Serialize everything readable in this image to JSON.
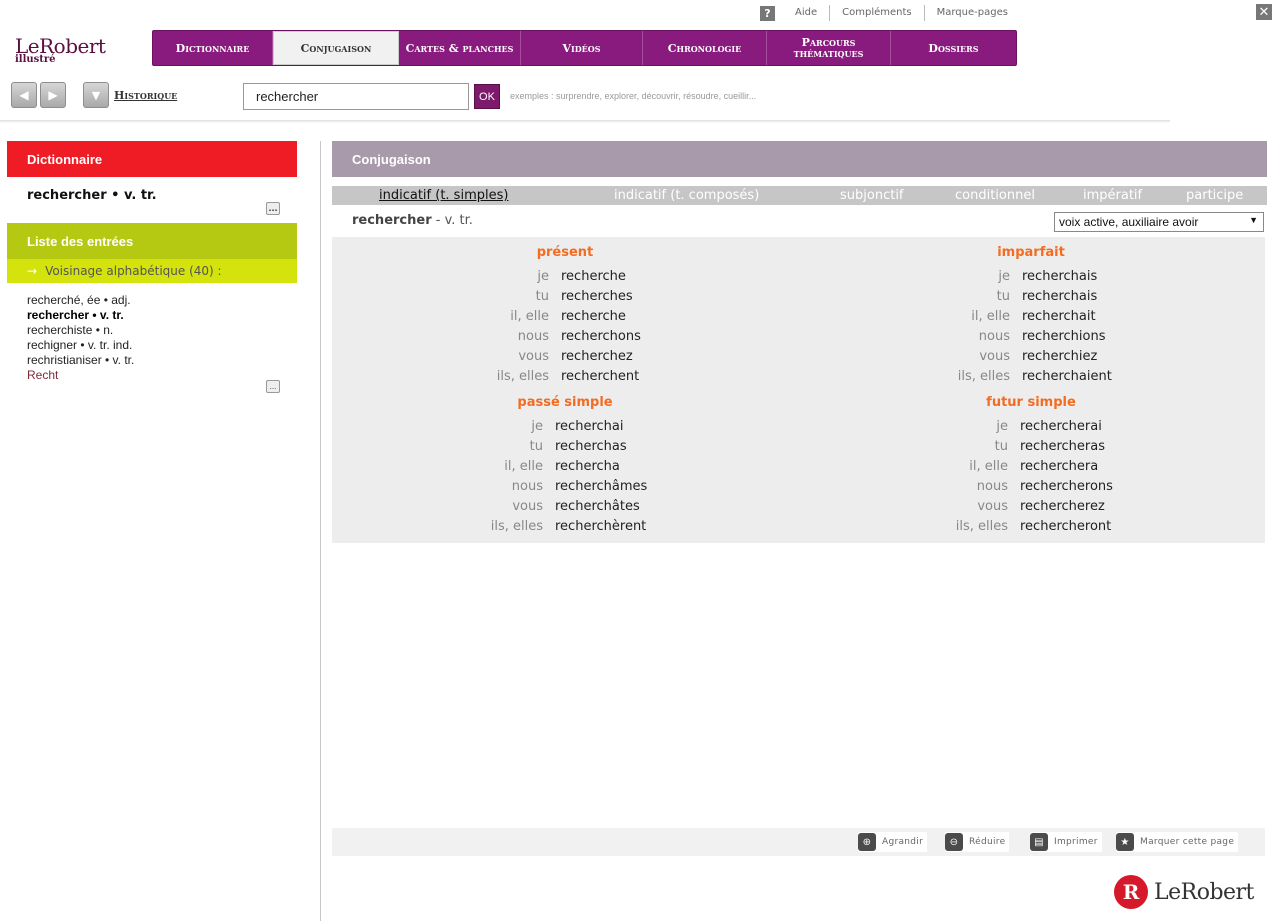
{
  "topbar": {
    "help_icon": "?",
    "links": [
      "Aide",
      "Compléments",
      "Marque-pages"
    ],
    "close_icon": "✕"
  },
  "logo": {
    "main": "LeRobert",
    "sub": "illustré"
  },
  "nav": {
    "tabs": [
      {
        "label": "Dictionnaire"
      },
      {
        "label": "Conjugaison",
        "active": true
      },
      {
        "label": "Cartes & planches"
      },
      {
        "label": "Vidéos"
      },
      {
        "label": "Chronologie"
      },
      {
        "label_line1": "Parcours",
        "label_line2": "thématiques"
      },
      {
        "label": "Dossiers"
      }
    ]
  },
  "toolbar": {
    "back_icon": "◀",
    "forward_icon": "▶",
    "history_dropdown_icon": "▼",
    "history_label": "Historique",
    "search_value": "rechercher",
    "ok_label": "OK",
    "examples": "exemples : surprendre, explorer, découvrir, résoudre, cueillir..."
  },
  "left": {
    "dict_title": "Dictionnaire",
    "dict_entry": "rechercher • v. tr.",
    "more_label": "...",
    "list_title": "Liste des entrées",
    "voisinage_arrow": "→",
    "voisinage": "Voisinage alphabétique (40) :",
    "entries": [
      {
        "text": "recherché, ée • adj."
      },
      {
        "text": "rechercher • v. tr.",
        "current": true
      },
      {
        "text": "recherchiste • n."
      },
      {
        "text": "rechigner • v. tr. ind."
      },
      {
        "text": "rechristianiser • v. tr."
      },
      {
        "text": "Recht",
        "link": true
      }
    ]
  },
  "conj": {
    "title": "Conjugaison",
    "modes": [
      {
        "label": "indicatif (t. simples)",
        "active": true
      },
      {
        "label": "indicatif (t. composés)"
      },
      {
        "label": "subjonctif"
      },
      {
        "label": "conditionnel"
      },
      {
        "label": "impératif"
      },
      {
        "label": "participe"
      }
    ],
    "verb": "rechercher",
    "verb_type": " - v. tr.",
    "voice": "voix active, auxiliaire avoir",
    "voice_caret": "▼",
    "tenses": [
      {
        "name": "présent",
        "rows": [
          [
            "je",
            "recherche"
          ],
          [
            "tu",
            "recherches"
          ],
          [
            "il, elle",
            "recherche"
          ],
          [
            "nous",
            "recherchons"
          ],
          [
            "vous",
            "recherchez"
          ],
          [
            "ils, elles",
            "recherchent"
          ]
        ]
      },
      {
        "name": "imparfait",
        "rows": [
          [
            "je",
            "recherchais"
          ],
          [
            "tu",
            "recherchais"
          ],
          [
            "il, elle",
            "recherchait"
          ],
          [
            "nous",
            "recherchions"
          ],
          [
            "vous",
            "recherchiez"
          ],
          [
            "ils, elles",
            "recherchaient"
          ]
        ]
      },
      {
        "name": "passé simple",
        "rows": [
          [
            "je",
            "recherchai"
          ],
          [
            "tu",
            "recherchas"
          ],
          [
            "il, elle",
            "rechercha"
          ],
          [
            "nous",
            "recherchâmes"
          ],
          [
            "vous",
            "recherchâtes"
          ],
          [
            "ils, elles",
            "recherchèrent"
          ]
        ]
      },
      {
        "name": "futur simple",
        "rows": [
          [
            "je",
            "rechercherai"
          ],
          [
            "tu",
            "rechercheras"
          ],
          [
            "il, elle",
            "recherchera"
          ],
          [
            "nous",
            "rechercherons"
          ],
          [
            "vous",
            "rechercherez"
          ],
          [
            "ils, elles",
            "rechercheront"
          ]
        ]
      }
    ]
  },
  "bottom": {
    "tools": [
      {
        "label": "Agrandir",
        "icon": "zoom-in-icon"
      },
      {
        "label": "Réduire",
        "icon": "zoom-out-icon"
      },
      {
        "label": "Imprimer",
        "icon": "print-icon"
      },
      {
        "label": "Marquer cette page",
        "icon": "bookmark-icon"
      }
    ]
  },
  "footer": {
    "logo_letter": "R",
    "logo_word": "LeRobert"
  },
  "colors": {
    "nav_bg": "#8a1b7e",
    "dict_header": "#ef1c25",
    "list_header": "#b5c912",
    "voisinage_bg": "#d4e30b",
    "conj_header": "#a89aaa",
    "tense_title": "#f36c21"
  }
}
